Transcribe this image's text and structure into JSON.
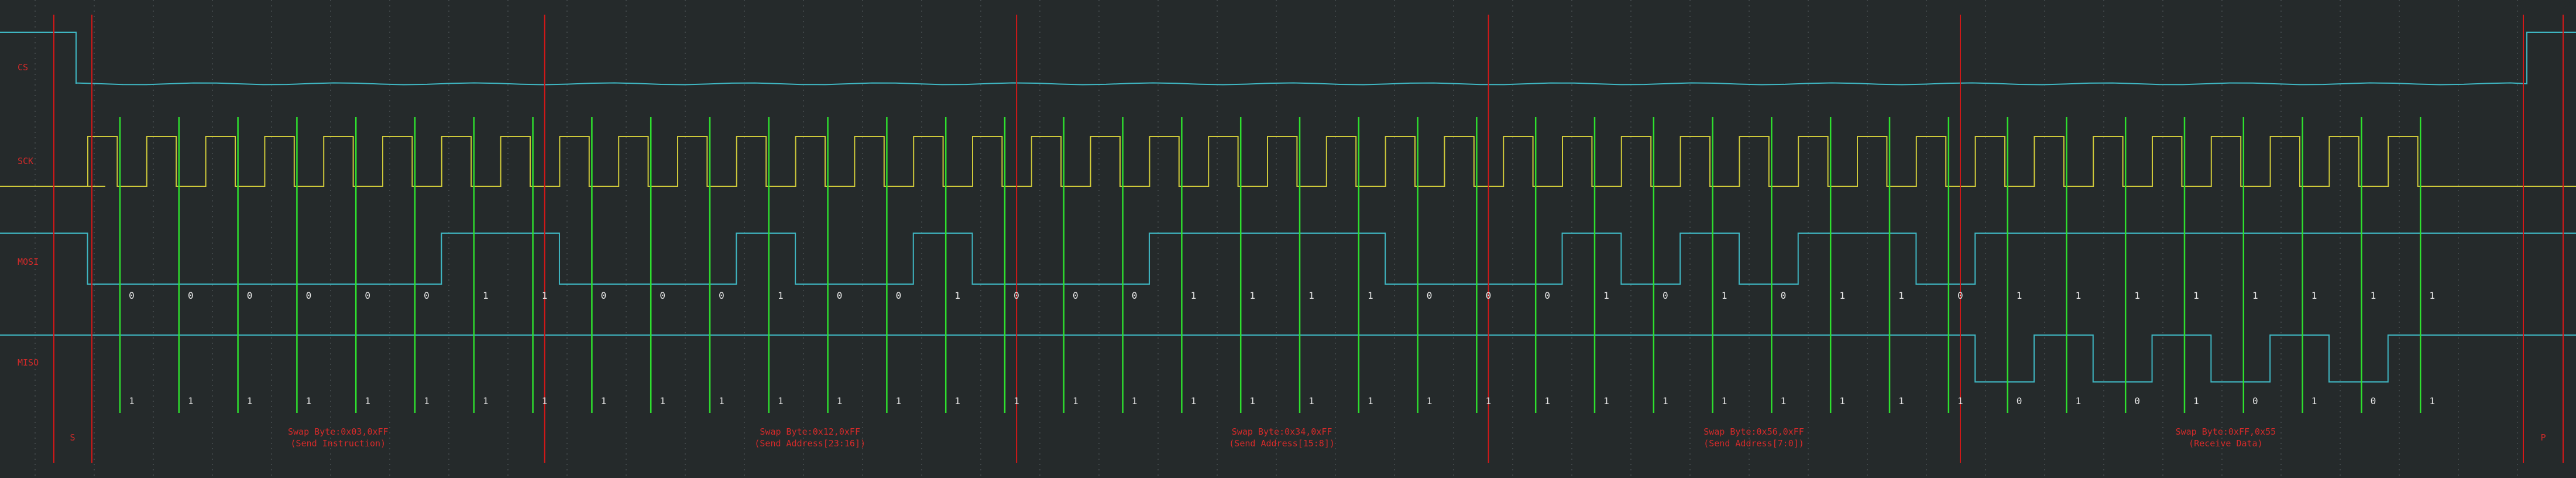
{
  "colors": {
    "background": "#252a2b",
    "grid": "#4a5052",
    "cs_trace": "#3fb6c2",
    "sck_trace": "#cfc93a",
    "data_trace": "#3fb6c2",
    "sample_marker": "#2ee02e",
    "byte_marker": "#d41818",
    "label": "#d42a2a"
  },
  "chart_data": {
    "type": "logic-analyzer",
    "channels": [
      {
        "id": "cs",
        "label": "CS"
      },
      {
        "id": "sck",
        "label": "SCK"
      },
      {
        "id": "mosi",
        "label": "MOSI"
      },
      {
        "id": "miso",
        "label": "MISO"
      }
    ],
    "bit_rows": {
      "mosi": [
        "0",
        "0",
        "0",
        "0",
        "0",
        "0",
        "1",
        "1",
        "0",
        "0",
        "0",
        "1",
        "0",
        "0",
        "1",
        "0",
        "0",
        "0",
        "1",
        "1",
        "1",
        "1",
        "0",
        "0",
        "0",
        "1",
        "0",
        "1",
        "0",
        "1",
        "1",
        "0",
        "1",
        "1",
        "1",
        "1",
        "1",
        "1",
        "1",
        "1"
      ],
      "miso": [
        "1",
        "1",
        "1",
        "1",
        "1",
        "1",
        "1",
        "1",
        "1",
        "1",
        "1",
        "1",
        "1",
        "1",
        "1",
        "1",
        "1",
        "1",
        "1",
        "1",
        "1",
        "1",
        "1",
        "1",
        "1",
        "1",
        "1",
        "1",
        "1",
        "1",
        "1",
        "1",
        "0",
        "1",
        "0",
        "1",
        "0",
        "1",
        "0",
        "1"
      ]
    },
    "bytes": [
      {
        "line1": "Swap Byte:0x03,0xFF",
        "line2": "(Send Instruction)"
      },
      {
        "line1": "Swap Byte:0x12,0xFF",
        "line2": "(Send Address[23:16])"
      },
      {
        "line1": "Swap Byte:0x34,0xFF",
        "line2": "(Send Address[15:8])"
      },
      {
        "line1": "Swap Byte:0x56,0xFF",
        "line2": "(Send Address[7:0])"
      },
      {
        "line1": "Swap Byte:0xFF,0x55",
        "line2": "(Receive Data)"
      }
    ],
    "start_marker": "S",
    "end_marker": "P"
  }
}
